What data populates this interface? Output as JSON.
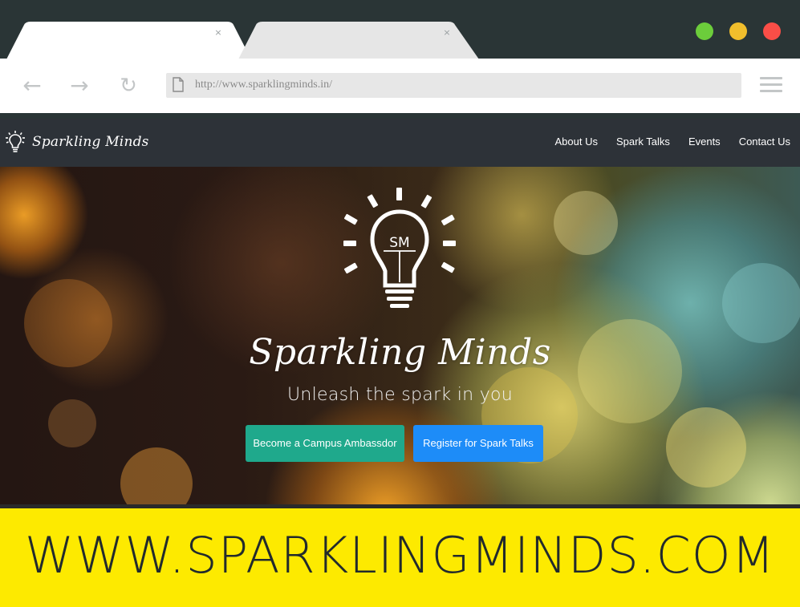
{
  "browser": {
    "tabs": [
      {
        "close_glyph": "×"
      },
      {
        "close_glyph": "×"
      }
    ],
    "nav": {
      "back_glyph": "←",
      "forward_glyph": "→",
      "reload_glyph": "↻"
    },
    "url": "http://www.sparklingminds.in/",
    "traffic_colors": {
      "green": "#6ccd3b",
      "yellow": "#f1be2c",
      "red": "#fb4e47"
    }
  },
  "site": {
    "brand": "Sparkling Minds",
    "nav_links": [
      "About Us",
      "Spark Talks",
      "Events",
      "Contact Us"
    ],
    "hero": {
      "logo_monogram": "SM",
      "title": "Sparkling Minds",
      "subtitle": "Unleash the spark in you",
      "buttons": {
        "ambassador": "Become a Campus Ambassdor",
        "register": "Register for Spark Talks"
      }
    }
  },
  "banner": {
    "text": "WWW.SPARKLINGMINDS.COM"
  },
  "colors": {
    "nav_bg": "#2d3238",
    "ambassador_btn": "#1fa98c",
    "register_btn": "#1d8cf8",
    "banner_bg": "#fdea00"
  },
  "icons": [
    "back-arrow-icon",
    "forward-arrow-icon",
    "reload-icon",
    "page-icon",
    "hamburger-menu-icon",
    "lightbulb-logo-icon"
  ]
}
